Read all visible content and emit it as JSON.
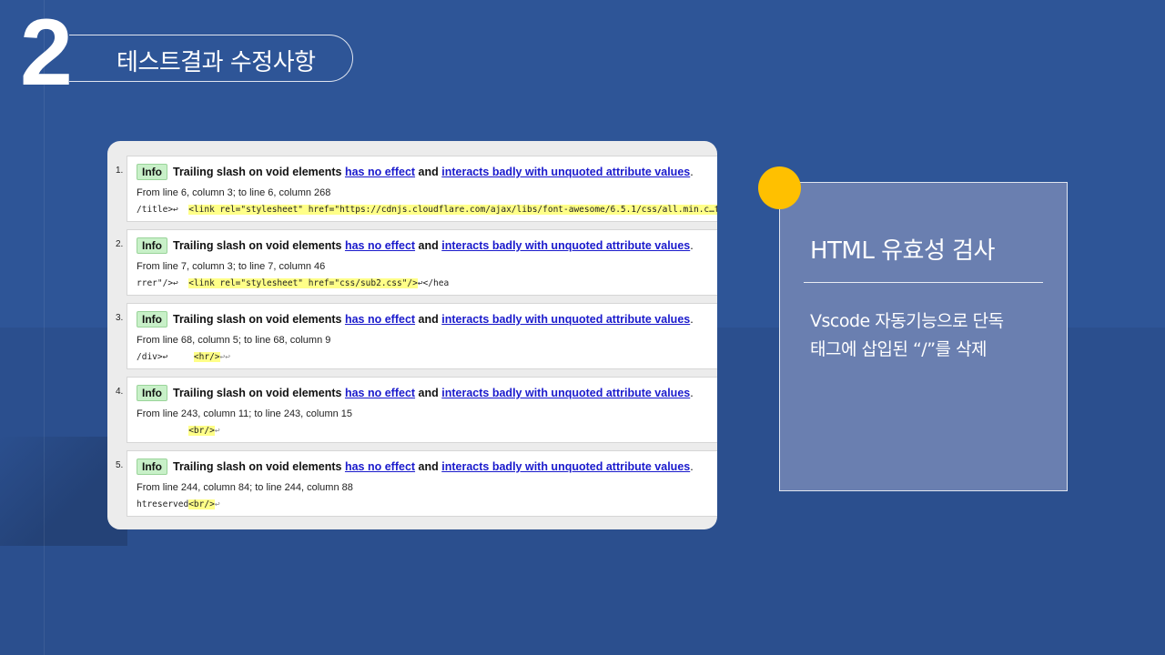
{
  "section": {
    "number": "2",
    "title": "테스트결과 수정사항"
  },
  "validator": {
    "badge": "Info",
    "message_prefix": "Trailing slash on void elements",
    "link1": "has no effect",
    "conjunction": "and",
    "link2": "interacts badly with unquoted attribute values",
    "period": ".",
    "entries": [
      {
        "index": "1.",
        "location": "From line 6, column 3; to line 6, column 268",
        "code_before": "/title>↩  ",
        "code_highlight": "<link rel=\"stylesheet\" href=\"https://cdnjs.cloudflare.com/ajax/libs/font-awesome/6.5.1/css/all.min.c…tl+Ve",
        "code_after": ""
      },
      {
        "index": "2.",
        "location": "From line 7, column 3; to line 7, column 46",
        "code_before": "rrer\"/>↩  ",
        "code_highlight": "<link rel=\"stylesheet\" href=\"css/sub2.css\"/>",
        "code_after": "↩</hea"
      },
      {
        "index": "3.",
        "location": "From line 68, column 5; to line 68, column 9",
        "code_before": "/div>↩     ",
        "code_highlight": "<hr/>",
        "code_after": "↩↩"
      },
      {
        "index": "4.",
        "location": "From line 243, column 11; to line 243, column 15",
        "code_before": "          ",
        "code_highlight": "<br/>",
        "code_after": "↩"
      },
      {
        "index": "5.",
        "location": "From line 244, column 84; to line 244, column 88",
        "code_before": "htreserved",
        "code_highlight": "<br/>",
        "code_after": "↩"
      }
    ]
  },
  "panel": {
    "title": "HTML 유효성 검사",
    "body_line1": "Vscode 자동기능으로 단독",
    "body_line2": "태그에 삽입된 “/”를 삭제"
  },
  "colors": {
    "background": "#2f5597",
    "accent_dot": "#ffc000",
    "badge_bg": "#c8f0c8",
    "highlight": "#ffff88",
    "link": "#1a1acc"
  }
}
